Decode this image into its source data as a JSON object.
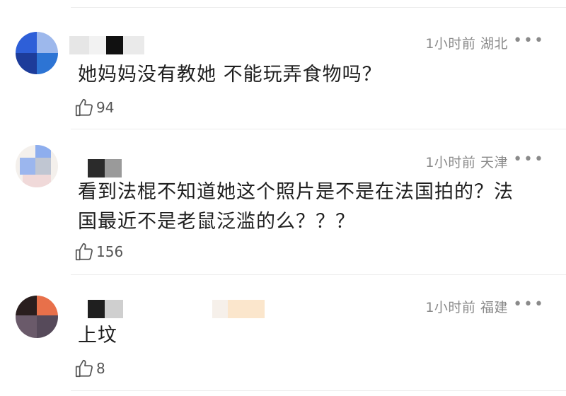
{
  "comments": [
    {
      "time": "1小时前",
      "location": "湖北",
      "text": "她妈妈没有教她 不能玩弄食物吗？",
      "likes": "94",
      "more_icon": "more-dots-icon"
    },
    {
      "time": "1小时前",
      "location": "天津",
      "text_line1": "看到法棍不知道她这个照片是不是在法国拍的？法",
      "text_line2": "国最近不是老鼠泛滥的么？？？",
      "likes": "156",
      "more_icon": "more-dots-icon"
    },
    {
      "time": "1小时前",
      "location": "福建",
      "text": "上坟",
      "likes": "8",
      "more_icon": "more-dots-icon"
    }
  ],
  "colors": {
    "meta": "#8a8a8a",
    "text": "#1f1f1f",
    "divider": "#ececec"
  }
}
